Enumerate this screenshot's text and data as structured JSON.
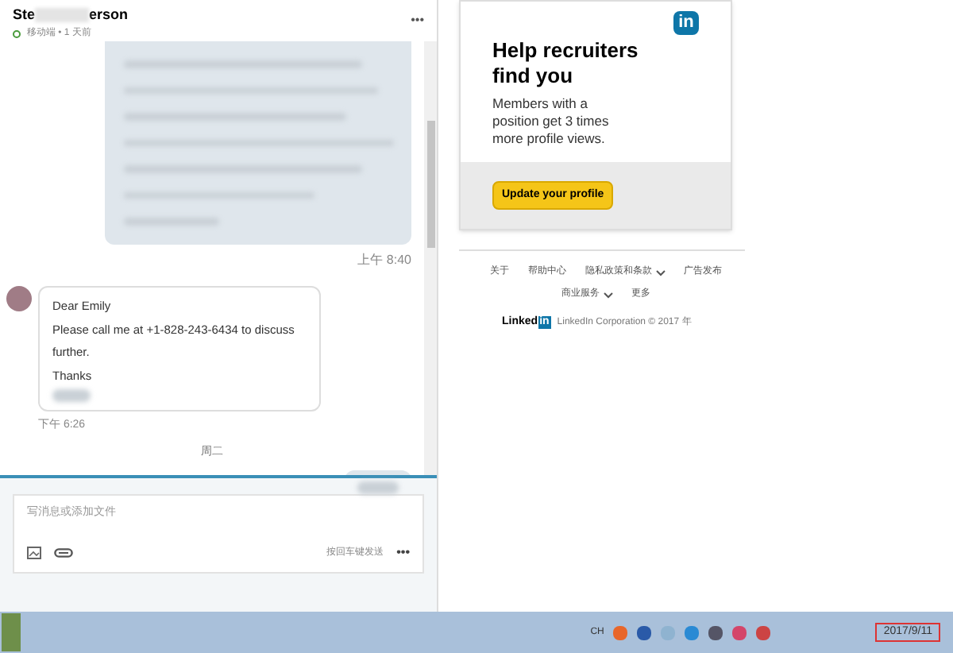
{
  "conversation": {
    "name_start": "Ste",
    "name_end": "erson",
    "status": "移动端 • 1 天前",
    "more": "•••"
  },
  "messages": [
    {
      "kind": "sent_blurred",
      "time": "上午 8:40"
    },
    {
      "kind": "received",
      "lines": [
        "Dear Emily",
        "Please call me at +1-828-243-6434 to discuss further.",
        "Thanks"
      ],
      "time": "下午 6:26"
    },
    {
      "kind": "day",
      "label": "周二"
    },
    {
      "kind": "sent_blurred_small"
    }
  ],
  "composer": {
    "placeholder": "写消息或添加文件",
    "send_hint": "按回车键发送",
    "more": "•••"
  },
  "ad": {
    "logo": "in",
    "title": "Help recruiters find you",
    "body": "Members with a position get 3 times more profile views.",
    "button": "Update your profile"
  },
  "footer": {
    "links": [
      {
        "label": "关于",
        "dropdown": false
      },
      {
        "label": "帮助中心",
        "dropdown": false
      },
      {
        "label": "隐私政策和条款",
        "dropdown": true
      },
      {
        "label": "广告发布",
        "dropdown": false
      },
      {
        "label": "商业服务",
        "dropdown": true
      },
      {
        "label": "更多",
        "dropdown": false
      }
    ],
    "brand": "Linked",
    "brand_box": "in",
    "copyright": "LinkedIn Corporation © 2017 年"
  },
  "taskbar": {
    "language": "CH",
    "date": "2017/9/11"
  }
}
